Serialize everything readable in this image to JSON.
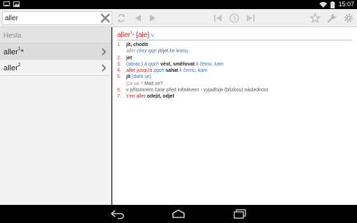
{
  "status": {
    "time": "15:07"
  },
  "search": {
    "value": "aller",
    "placeholder": ""
  },
  "sidebar": {
    "header": "Hesla",
    "items": [
      {
        "word": "aller",
        "sup": "1",
        "mark": "*"
      },
      {
        "word": "aller",
        "sup": "2",
        "mark": ""
      }
    ]
  },
  "entry": {
    "word": "aller",
    "word_sup": "1",
    "word_mark": "*",
    "pron": "[ale]",
    "pos": "v",
    "senses": [
      {
        "num": "1.",
        "parts": [
          {
            "t": "jít, chodit",
            "c": "bold"
          }
        ],
        "sub": [
          {
            "t": "aller ",
            "c": "gray-i"
          },
          {
            "t": "chez qqn",
            "c": "blue-i"
          },
          {
            "t": " jít/jet ",
            "c": "ex"
          },
          {
            "t": "ke komu",
            "c": "blue-i"
          }
        ]
      },
      {
        "num": "2.",
        "parts": [
          {
            "t": "jet",
            "c": "bold"
          }
        ]
      },
      {
        "num": "3.",
        "parts": [
          {
            "t": "(obraz.) ",
            "c": "blue"
          },
          {
            "t": "à qqch",
            "c": "blue-i"
          },
          {
            "t": " vést, směřovat ",
            "c": "bold"
          },
          {
            "t": "k čemu, kam",
            "c": "blue-i"
          }
        ]
      },
      {
        "num": "4.",
        "parts": [
          {
            "t": "aller jusqu'à",
            "c": "red"
          },
          {
            "t": " qqch",
            "c": "blue-i"
          },
          {
            "t": " sahat ",
            "c": "bold"
          },
          {
            "t": "k čemu, kam",
            "c": "blue-i"
          }
        ]
      },
      {
        "num": "5.",
        "parts": [
          {
            "t": "jít",
            "c": "bold"
          },
          {
            "t": " (dařit se)",
            "c": "blue"
          }
        ],
        "sub": [
          {
            "t": "Ça va ?",
            "c": "gray-i"
          },
          {
            "t": " Máš se?",
            "c": "ex"
          }
        ]
      },
      {
        "num": "6.",
        "parts": [
          {
            "t": "v přítomném čase před infinitivem - vyjadřuje (blízkou) následnost",
            "c": "ex"
          }
        ]
      },
      {
        "num": "7.",
        "parts": [
          {
            "t": "s'en aller",
            "c": "red"
          },
          {
            "t": " odejít, odjet",
            "c": "bold"
          }
        ]
      }
    ]
  },
  "colors": {
    "accent_red": "#c62020",
    "accent_blue": "#3d6fae",
    "toolbar_bg": "#efefef"
  },
  "icons": {
    "toolbar": [
      "refresh-icon",
      "back-icon",
      "forward-icon",
      "first-icon",
      "history-icon",
      "last-icon",
      "star-icon",
      "wrench-icon",
      "settings-icon"
    ],
    "nav": [
      "back-nav-icon",
      "home-nav-icon",
      "recents-nav-icon"
    ]
  }
}
